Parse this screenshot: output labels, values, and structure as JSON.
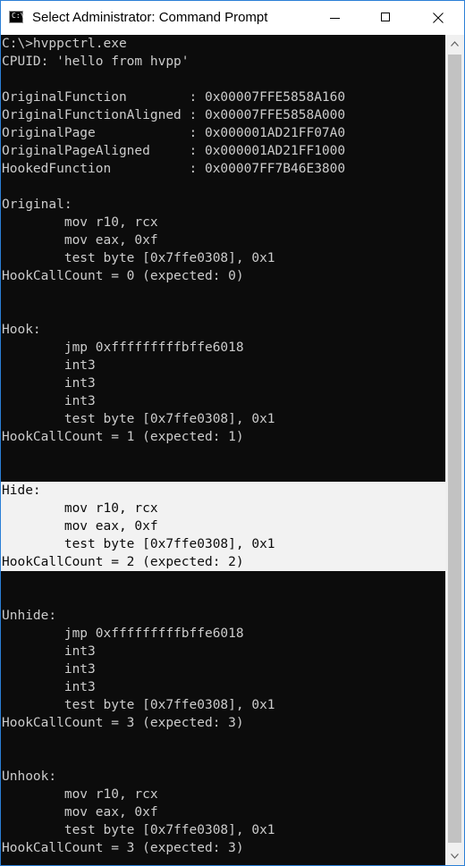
{
  "window": {
    "title": "Select Administrator: Command Prompt",
    "icon_glyph": "C:\\",
    "icons": {
      "app": "command-prompt-icon",
      "minimize": "minimize-icon",
      "maximize": "maximize-icon",
      "close": "close-icon",
      "scroll_up": "chevron-up-icon",
      "scroll_down": "chevron-down-icon"
    }
  },
  "colors": {
    "console_background": "#0c0c0c",
    "console_text": "#cccccc",
    "selection_background": "#f2f2f2",
    "selection_text": "#0c0c0c"
  },
  "console": {
    "lines": [
      "C:\\>hvppctrl.exe",
      "CPUID: 'hello from hvpp'",
      "",
      "OriginalFunction        : 0x00007FFE5858A160",
      "OriginalFunctionAligned : 0x00007FFE5858A000",
      "OriginalPage            : 0x000001AD21FF07A0",
      "OriginalPageAligned     : 0x000001AD21FF1000",
      "HookedFunction          : 0x00007FF7B46E3800",
      "",
      "Original:",
      "        mov r10, rcx",
      "        mov eax, 0xf",
      "        test byte [0x7ffe0308], 0x1",
      "HookCallCount = 0 (expected: 0)",
      "",
      "",
      "Hook:",
      "        jmp 0xfffffffffbffe6018",
      "        int3",
      "        int3",
      "        int3",
      "        test byte [0x7ffe0308], 0x1",
      "HookCallCount = 1 (expected: 1)",
      "",
      "",
      "Hide:",
      "        mov r10, rcx",
      "        mov eax, 0xf",
      "        test byte [0x7ffe0308], 0x1",
      "HookCallCount = 2 (expected: 2)",
      "",
      "",
      "Unhide:",
      "        jmp 0xfffffffffbffe6018",
      "        int3",
      "        int3",
      "        int3",
      "        test byte [0x7ffe0308], 0x1",
      "HookCallCount = 3 (expected: 3)",
      "",
      "",
      "Unhook:",
      "        mov r10, rcx",
      "        mov eax, 0xf",
      "        test byte [0x7ffe0308], 0x1",
      "HookCallCount = 3 (expected: 3)"
    ],
    "selected_lines": [
      25,
      26,
      27,
      28,
      29
    ]
  }
}
